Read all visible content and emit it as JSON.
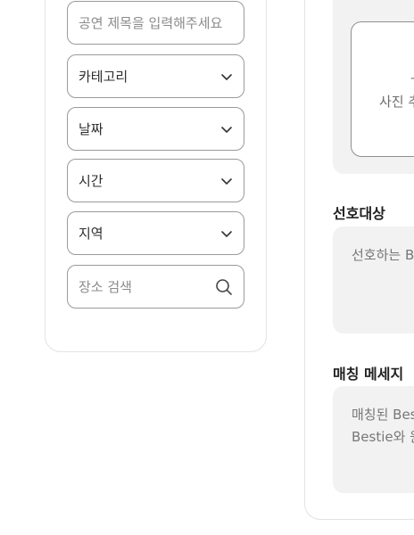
{
  "filters": {
    "title_placeholder": "공연 제목을 입력해주세요",
    "category_label": "카테고리",
    "date_label": "날짜",
    "time_label": "시간",
    "region_label": "지역",
    "place_placeholder": "장소 검색"
  },
  "form": {
    "photo_label": "사진 추",
    "photo_plus": "+",
    "preference_title": "선호대상",
    "preference_placeholder": "선호하는 B",
    "message_title": "매칭 메세지",
    "message_placeholder_line1": "매칭된 Bes",
    "message_placeholder_line2": "Bestie와 원"
  }
}
